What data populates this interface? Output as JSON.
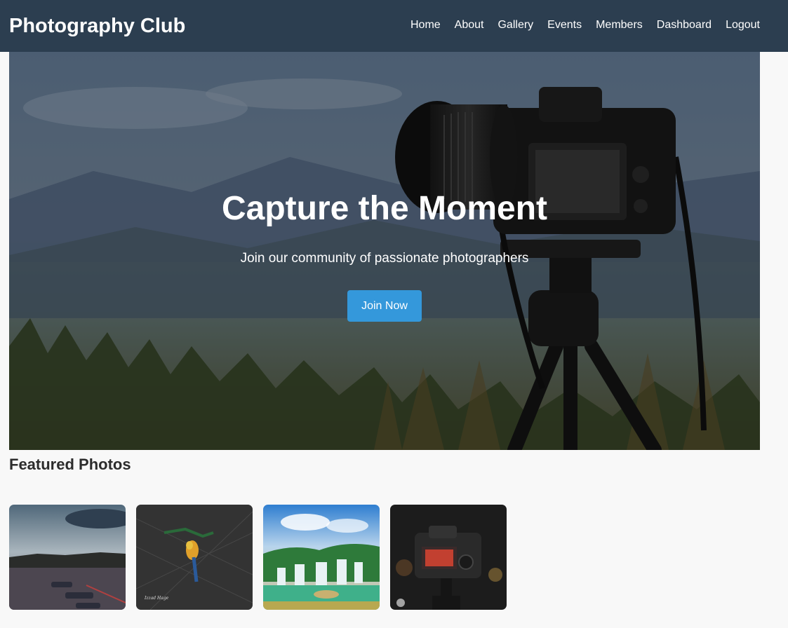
{
  "header": {
    "brand": "Photography Club",
    "nav": [
      "Home",
      "About",
      "Gallery",
      "Events",
      "Members",
      "Dashboard",
      "Logout"
    ]
  },
  "hero": {
    "title": "Capture the Moment",
    "subtitle": "Join our community of passionate photographers",
    "cta_label": "Join Now",
    "image_icon": "camera-on-tripod-photo"
  },
  "featured": {
    "heading": "Featured Photos",
    "photos": [
      {
        "icon": "harbor-boats-photo"
      },
      {
        "icon": "parrot-photo"
      },
      {
        "icon": "waterfall-photo"
      },
      {
        "icon": "camera-photo"
      }
    ]
  },
  "colors": {
    "header_bg": "#2c3e50",
    "accent": "#3498db",
    "page_bg": "#f8f8f8"
  }
}
